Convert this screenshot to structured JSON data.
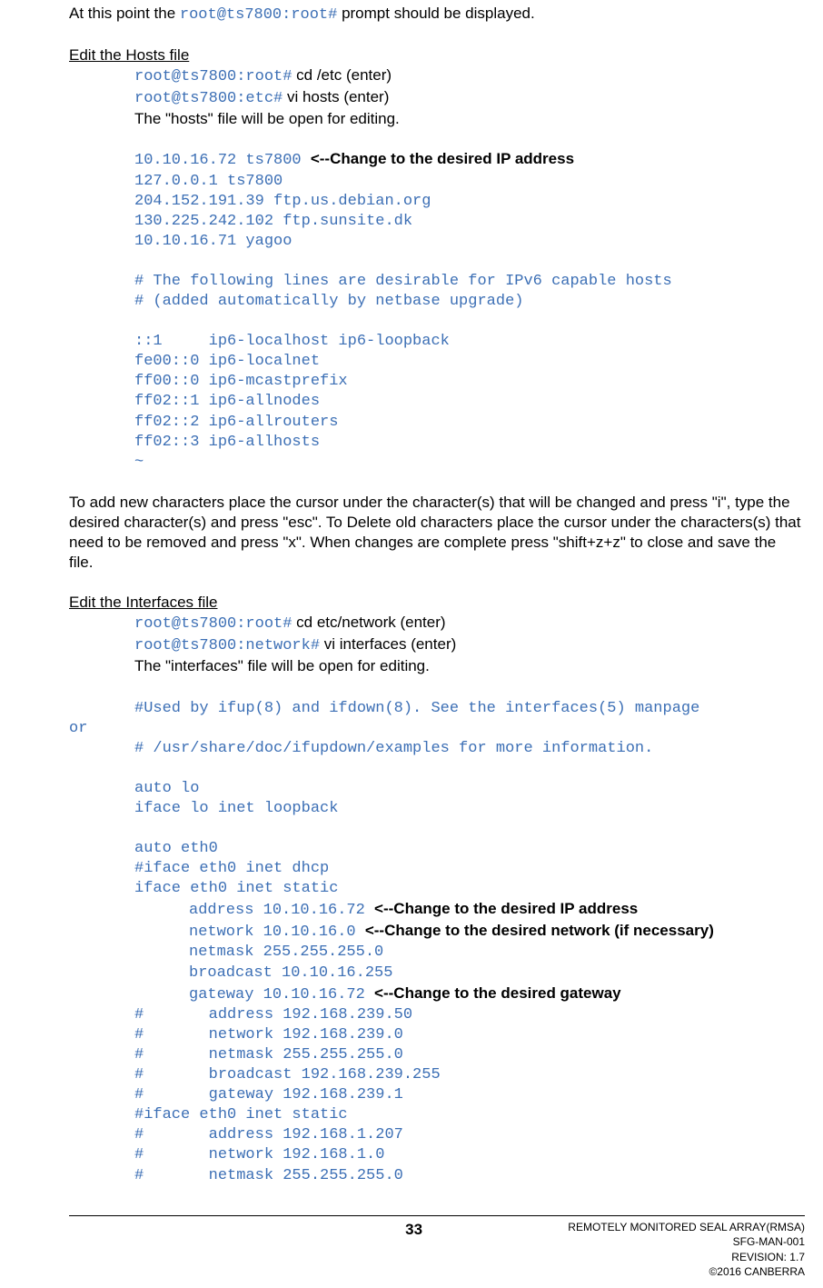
{
  "intro": {
    "prefix": "At this point the ",
    "prompt": "root@ts7800:root#",
    "suffix": " prompt should be displayed."
  },
  "hosts": {
    "heading": "Edit the Hosts file",
    "line1_prompt": "root@ts7800:root#",
    "line1_cmd": " cd /etc (enter)",
    "line2_prompt": "root@ts7800:etc#",
    "line2_cmd": " vi hosts (enter)",
    "line3": "The \"hosts\" file will be open for editing.",
    "file": {
      "l1_code": "10.10.16.72 ts7800 ",
      "l1_note": "<--Change to the desired IP address",
      "l2": "127.0.0.1 ts7800",
      "l3": "204.152.191.39 ftp.us.debian.org",
      "l4": "130.225.242.102 ftp.sunsite.dk",
      "l5": "10.10.16.71 yagoo",
      "l6": "# The following lines are desirable for IPv6 capable hosts",
      "l7": "# (added automatically by netbase upgrade)",
      "l8": "::1     ip6-localhost ip6-loopback",
      "l9": "fe00::0 ip6-localnet",
      "l10": "ff00::0 ip6-mcastprefix",
      "l11": "ff02::1 ip6-allnodes",
      "l12": "ff02::2 ip6-allrouters",
      "l13": "ff02::3 ip6-allhosts",
      "l14": "~"
    }
  },
  "vi_instructions": "To add new characters place the cursor under the character(s) that will be changed and press \"i\", type the desired character(s) and press \"esc\".  To Delete old characters place the cursor under the characters(s) that need to be removed and press \"x\".  When changes are complete press \"shift+z+z\" to close and save the file.",
  "interfaces": {
    "heading": "Edit the Interfaces file",
    "line1_prompt": "root@ts7800:root#",
    "line1_cmd": " cd etc/network (enter)",
    "line2_prompt": "root@ts7800:network#",
    "line2_cmd": " vi interfaces (enter)",
    "line3": "The \"interfaces\" file will be open for editing.",
    "file": {
      "l1_indent": "#Used by ifup(8) and ifdown(8). See the interfaces(5) manpage ",
      "l1_wrap": "or",
      "l2": "# /usr/share/doc/ifupdown/examples for more information.",
      "l3": "auto lo",
      "l4": "iface lo inet loopback",
      "l5": "auto eth0",
      "l6": "#iface eth0 inet dhcp",
      "l7": "iface eth0 inet static",
      "l8_code": "address 10.10.16.72 ",
      "l8_note": "<--Change to the desired IP address",
      "l9_code": "network 10.10.16.0 ",
      "l9_note": "<--Change to the desired network (if necessary)",
      "l10": "netmask 255.255.255.0",
      "l11": "broadcast 10.10.16.255",
      "l12_code": "gateway 10.10.16.72 ",
      "l12_note": "<--Change to the desired gateway",
      "l13": "#       address 192.168.239.50",
      "l14": "#       network 192.168.239.0",
      "l15": "#       netmask 255.255.255.0",
      "l16": "#       broadcast 192.168.239.255",
      "l17": "#       gateway 192.168.239.1",
      "l18": "#iface eth0 inet static",
      "l19": "#       address 192.168.1.207",
      "l20": "#       network 192.168.1.0",
      "l21": "#       netmask 255.255.255.0"
    }
  },
  "footer": {
    "page": "33",
    "r1": "REMOTELY MONITORED SEAL ARRAY(RMSA)",
    "r2": "SFG-MAN-001",
    "r3": "REVISION: 1.7",
    "r4": "©2016 CANBERRA"
  }
}
